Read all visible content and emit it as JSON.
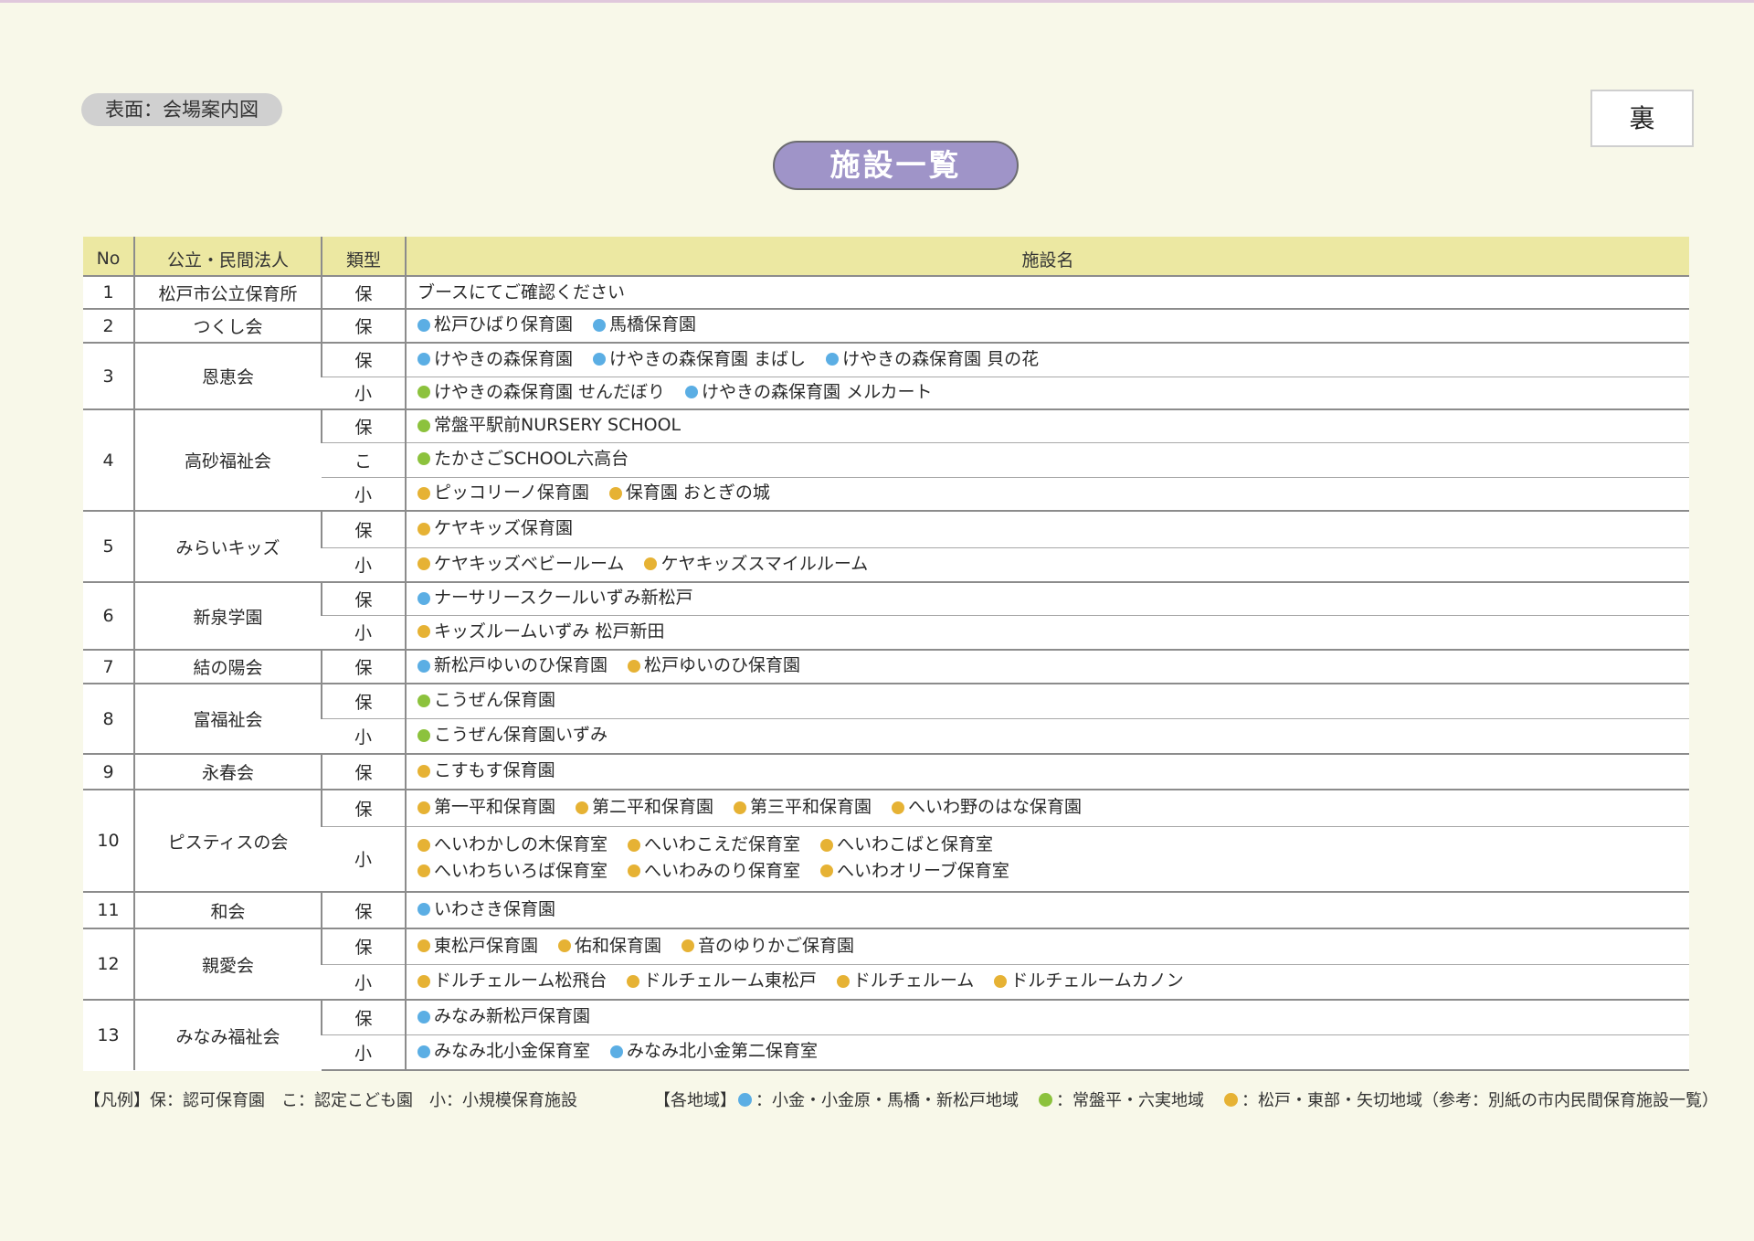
{
  "side_tag": "表面：会場案内図",
  "page_label": "裏",
  "title": "施設一覧",
  "colors": {
    "blue": "#5baee4",
    "green": "#8cc23d",
    "orange": "#e6b234",
    "header_bg": "#ece8a2",
    "title_bg": "#9f94c8"
  },
  "table": {
    "headers": [
      "No",
      "公立・民間法人",
      "類型",
      "施設名"
    ],
    "rows": [
      {
        "no": "1",
        "org": "松戸市公立保育所",
        "rows": [
          {
            "type": "保",
            "h": 36,
            "lines": [
              [
                {
                  "name": "ブースにてご確認ください",
                  "color": ""
                }
              ]
            ]
          }
        ]
      },
      {
        "no": "2",
        "org": "つくし会",
        "rows": [
          {
            "type": "保",
            "h": 37,
            "lines": [
              [
                {
                  "name": "松戸ひばり保育園",
                  "color": "blue"
                },
                {
                  "name": "馬橋保育園",
                  "color": "blue"
                }
              ]
            ]
          }
        ]
      },
      {
        "no": "3",
        "org": "恩恵会",
        "rows": [
          {
            "type": "保",
            "h": 37,
            "lines": [
              [
                {
                  "name": "けやきの森保育園",
                  "color": "blue"
                },
                {
                  "name": "けやきの森保育園 まばし",
                  "color": "blue"
                },
                {
                  "name": "けやきの森保育園 貝の花",
                  "color": "blue"
                }
              ]
            ]
          },
          {
            "type": "小",
            "h": 36,
            "lines": [
              [
                {
                  "name": "けやきの森保育園 せんだぼり",
                  "color": "green"
                },
                {
                  "name": "けやきの森保育園 メルカート",
                  "color": "blue"
                }
              ]
            ]
          }
        ]
      },
      {
        "no": "4",
        "org": "高砂福祉会",
        "rows": [
          {
            "type": "保",
            "h": 36,
            "lines": [
              [
                {
                  "name": "常盤平駅前NURSERY SCHOOL",
                  "color": "green"
                }
              ]
            ]
          },
          {
            "type": "こ",
            "h": 38,
            "lines": [
              [
                {
                  "name": "たかさごSCHOOL六高台",
                  "color": "green"
                }
              ]
            ]
          },
          {
            "type": "小",
            "h": 37,
            "lines": [
              [
                {
                  "name": "ピッコリーノ保育園",
                  "color": "orange"
                },
                {
                  "name": "保育園 おとぎの城",
                  "color": "orange"
                }
              ]
            ]
          }
        ]
      },
      {
        "no": "5",
        "org": "みらいキッズ",
        "rows": [
          {
            "type": "保",
            "h": 40,
            "lines": [
              [
                {
                  "name": "ケヤキッズ保育園",
                  "color": "orange"
                }
              ]
            ]
          },
          {
            "type": "小",
            "h": 38,
            "lines": [
              [
                {
                  "name": "ケヤキッズベビールーム",
                  "color": "orange"
                },
                {
                  "name": "ケヤキッズスマイルルーム",
                  "color": "orange"
                }
              ]
            ]
          }
        ]
      },
      {
        "no": "6",
        "org": "新泉学園",
        "rows": [
          {
            "type": "保",
            "h": 36,
            "lines": [
              [
                {
                  "name": "ナーサリースクールいずみ新松戸",
                  "color": "blue"
                }
              ]
            ]
          },
          {
            "type": "小",
            "h": 38,
            "lines": [
              [
                {
                  "name": "キッズルームいずみ 松戸新田",
                  "color": "orange"
                }
              ]
            ]
          }
        ]
      },
      {
        "no": "7",
        "org": "結の陽会",
        "rows": [
          {
            "type": "保",
            "h": 37,
            "lines": [
              [
                {
                  "name": "新松戸ゆいのひ保育園",
                  "color": "blue"
                },
                {
                  "name": "松戸ゆいのひ保育園",
                  "color": "orange"
                }
              ]
            ]
          }
        ]
      },
      {
        "no": "8",
        "org": "富福祉会",
        "rows": [
          {
            "type": "保",
            "h": 38,
            "lines": [
              [
                {
                  "name": "こうぜん保育園",
                  "color": "green"
                }
              ]
            ]
          },
          {
            "type": "小",
            "h": 39,
            "lines": [
              [
                {
                  "name": "こうぜん保育園いずみ",
                  "color": "green"
                }
              ]
            ]
          }
        ]
      },
      {
        "no": "9",
        "org": "永春会",
        "rows": [
          {
            "type": "保",
            "h": 39,
            "lines": [
              [
                {
                  "name": "こすもす保育園",
                  "color": "orange"
                }
              ]
            ]
          }
        ]
      },
      {
        "no": "10",
        "org": "ピスティスの会",
        "rows": [
          {
            "type": "保",
            "h": 40,
            "lines": [
              [
                {
                  "name": "第一平和保育園",
                  "color": "orange"
                },
                {
                  "name": "第二平和保育園",
                  "color": "orange"
                },
                {
                  "name": "第三平和保育園",
                  "color": "orange"
                },
                {
                  "name": "へいわ野のはな保育園",
                  "color": "orange"
                }
              ]
            ]
          },
          {
            "type": "小",
            "h": 72,
            "lines": [
              [
                {
                  "name": "へいわかしの木保育室",
                  "color": "orange"
                },
                {
                  "name": "へいわこえだ保育室",
                  "color": "orange"
                },
                {
                  "name": "へいわこばと保育室",
                  "color": "orange"
                }
              ],
              [
                {
                  "name": "へいわちいろば保育室",
                  "color": "orange"
                },
                {
                  "name": "へいわみのり保育室",
                  "color": "orange"
                },
                {
                  "name": "へいわオリーブ保育室",
                  "color": "orange"
                }
              ]
            ]
          }
        ]
      },
      {
        "no": "11",
        "org": "和会",
        "rows": [
          {
            "type": "保",
            "h": 40,
            "lines": [
              [
                {
                  "name": "いわさき保育園",
                  "color": "blue"
                }
              ]
            ]
          }
        ]
      },
      {
        "no": "12",
        "org": "親愛会",
        "rows": [
          {
            "type": "保",
            "h": 39,
            "lines": [
              [
                {
                  "name": "東松戸保育園",
                  "color": "orange"
                },
                {
                  "name": "佑和保育園",
                  "color": "orange"
                },
                {
                  "name": "音のゆりかご保育園",
                  "color": "orange"
                }
              ]
            ]
          },
          {
            "type": "小",
            "h": 39,
            "lines": [
              [
                {
                  "name": "ドルチェルーム松飛台",
                  "color": "orange"
                },
                {
                  "name": "ドルチェルーム東松戸",
                  "color": "orange"
                },
                {
                  "name": "ドルチェルーム",
                  "color": "orange"
                },
                {
                  "name": "ドルチェルームカノン",
                  "color": "orange"
                }
              ]
            ]
          }
        ]
      },
      {
        "no": "13",
        "org": "みなみ福祉会",
        "rows": [
          {
            "type": "保",
            "h": 38,
            "lines": [
              [
                {
                  "name": "みなみ新松戸保育園",
                  "color": "blue"
                }
              ]
            ]
          },
          {
            "type": "小",
            "h": 39,
            "lines": [
              [
                {
                  "name": "みなみ北小金保育室",
                  "color": "blue"
                },
                {
                  "name": "みなみ北小金第二保育室",
                  "color": "blue"
                }
              ]
            ]
          }
        ]
      }
    ]
  },
  "legend": {
    "types": "【凡例】保：認可保育園　こ：認定こども園　小：小規模保育施設",
    "areas_label": "【各地域】",
    "areas": [
      {
        "color": "blue",
        "text": "：小金・小金原・馬橋・新松戸地域"
      },
      {
        "color": "green",
        "text": "：常盤平・六実地域"
      },
      {
        "color": "orange",
        "text": "：松戸・東部・矢切地域（参考：別紙の市内民間保育施設一覧）"
      }
    ]
  }
}
